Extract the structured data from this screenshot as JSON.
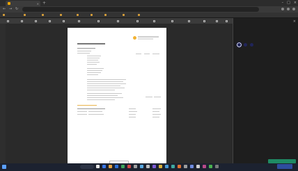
{
  "colors": {
    "accent": "#f2b233",
    "sidebar_button": "#1f8a64",
    "color_swatch": "#20255a",
    "taskbar_icons": [
      "#e8e8e8",
      "#3b78e7",
      "#e6a23c",
      "#2b6fd6",
      "#3ca55c",
      "#d04545",
      "#a0a0a0",
      "#58a8e0",
      "#c0c0c0",
      "#7d5cd6",
      "#d8b038",
      "#4a9bd8",
      "#3fa9a0",
      "#e07030",
      "#9c9c9c",
      "#6e8be0",
      "#d0d0d0",
      "#b84a8a",
      "#49b04f",
      "#7a7a7a"
    ]
  },
  "icons": {
    "start": "windows-start-icon",
    "search": "search-icon",
    "back": "back-arrow-icon",
    "forward": "forward-arrow-icon",
    "reload": "reload-icon",
    "close": "close-icon"
  }
}
